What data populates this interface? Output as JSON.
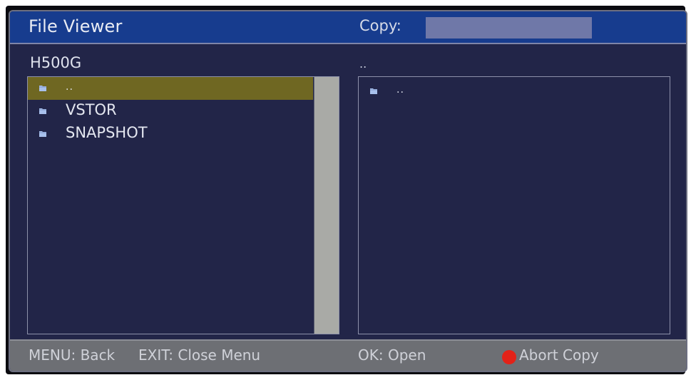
{
  "header": {
    "title": "File Viewer",
    "copy_label": "Copy:",
    "copy_progress": 0
  },
  "left_pane": {
    "path": "H500G",
    "items": [
      {
        "label": "..",
        "icon": "folder-icon",
        "selected": true
      },
      {
        "label": "VSTOR",
        "icon": "folder-icon",
        "selected": false
      },
      {
        "label": "SNAPSHOT",
        "icon": "folder-icon",
        "selected": false
      }
    ]
  },
  "right_pane": {
    "path": "..",
    "items": [
      {
        "label": "..",
        "icon": "folder-icon"
      }
    ]
  },
  "footer": {
    "menu": "MENU: Back",
    "exit": "EXIT: Close Menu",
    "ok": "OK: Open",
    "abort": "Abort Copy"
  },
  "colors": {
    "title_bar": "#173c8e",
    "background": "#222548",
    "selected_row": "#6f6722",
    "footer": "#6d6f74",
    "red_button": "#e32218"
  }
}
